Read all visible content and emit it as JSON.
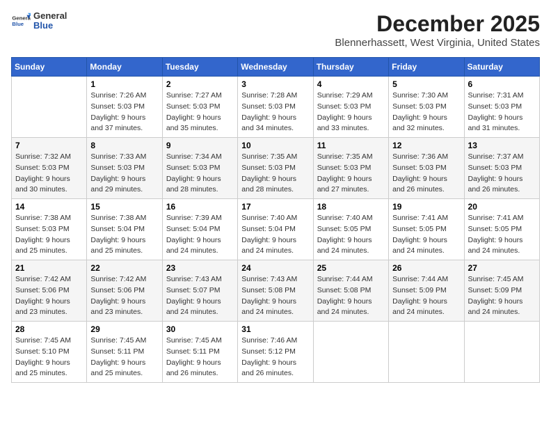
{
  "header": {
    "logo_general": "General",
    "logo_blue": "Blue",
    "title": "December 2025",
    "subtitle": "Blennerhassett, West Virginia, United States"
  },
  "columns": [
    "Sunday",
    "Monday",
    "Tuesday",
    "Wednesday",
    "Thursday",
    "Friday",
    "Saturday"
  ],
  "weeks": [
    [
      {
        "day": "",
        "info": ""
      },
      {
        "day": "1",
        "info": "Sunrise: 7:26 AM\nSunset: 5:03 PM\nDaylight: 9 hours\nand 37 minutes."
      },
      {
        "day": "2",
        "info": "Sunrise: 7:27 AM\nSunset: 5:03 PM\nDaylight: 9 hours\nand 35 minutes."
      },
      {
        "day": "3",
        "info": "Sunrise: 7:28 AM\nSunset: 5:03 PM\nDaylight: 9 hours\nand 34 minutes."
      },
      {
        "day": "4",
        "info": "Sunrise: 7:29 AM\nSunset: 5:03 PM\nDaylight: 9 hours\nand 33 minutes."
      },
      {
        "day": "5",
        "info": "Sunrise: 7:30 AM\nSunset: 5:03 PM\nDaylight: 9 hours\nand 32 minutes."
      },
      {
        "day": "6",
        "info": "Sunrise: 7:31 AM\nSunset: 5:03 PM\nDaylight: 9 hours\nand 31 minutes."
      }
    ],
    [
      {
        "day": "7",
        "info": "Sunrise: 7:32 AM\nSunset: 5:03 PM\nDaylight: 9 hours\nand 30 minutes."
      },
      {
        "day": "8",
        "info": "Sunrise: 7:33 AM\nSunset: 5:03 PM\nDaylight: 9 hours\nand 29 minutes."
      },
      {
        "day": "9",
        "info": "Sunrise: 7:34 AM\nSunset: 5:03 PM\nDaylight: 9 hours\nand 28 minutes."
      },
      {
        "day": "10",
        "info": "Sunrise: 7:35 AM\nSunset: 5:03 PM\nDaylight: 9 hours\nand 28 minutes."
      },
      {
        "day": "11",
        "info": "Sunrise: 7:35 AM\nSunset: 5:03 PM\nDaylight: 9 hours\nand 27 minutes."
      },
      {
        "day": "12",
        "info": "Sunrise: 7:36 AM\nSunset: 5:03 PM\nDaylight: 9 hours\nand 26 minutes."
      },
      {
        "day": "13",
        "info": "Sunrise: 7:37 AM\nSunset: 5:03 PM\nDaylight: 9 hours\nand 26 minutes."
      }
    ],
    [
      {
        "day": "14",
        "info": "Sunrise: 7:38 AM\nSunset: 5:03 PM\nDaylight: 9 hours\nand 25 minutes."
      },
      {
        "day": "15",
        "info": "Sunrise: 7:38 AM\nSunset: 5:04 PM\nDaylight: 9 hours\nand 25 minutes."
      },
      {
        "day": "16",
        "info": "Sunrise: 7:39 AM\nSunset: 5:04 PM\nDaylight: 9 hours\nand 24 minutes."
      },
      {
        "day": "17",
        "info": "Sunrise: 7:40 AM\nSunset: 5:04 PM\nDaylight: 9 hours\nand 24 minutes."
      },
      {
        "day": "18",
        "info": "Sunrise: 7:40 AM\nSunset: 5:05 PM\nDaylight: 9 hours\nand 24 minutes."
      },
      {
        "day": "19",
        "info": "Sunrise: 7:41 AM\nSunset: 5:05 PM\nDaylight: 9 hours\nand 24 minutes."
      },
      {
        "day": "20",
        "info": "Sunrise: 7:41 AM\nSunset: 5:05 PM\nDaylight: 9 hours\nand 24 minutes."
      }
    ],
    [
      {
        "day": "21",
        "info": "Sunrise: 7:42 AM\nSunset: 5:06 PM\nDaylight: 9 hours\nand 23 minutes."
      },
      {
        "day": "22",
        "info": "Sunrise: 7:42 AM\nSunset: 5:06 PM\nDaylight: 9 hours\nand 23 minutes."
      },
      {
        "day": "23",
        "info": "Sunrise: 7:43 AM\nSunset: 5:07 PM\nDaylight: 9 hours\nand 24 minutes."
      },
      {
        "day": "24",
        "info": "Sunrise: 7:43 AM\nSunset: 5:08 PM\nDaylight: 9 hours\nand 24 minutes."
      },
      {
        "day": "25",
        "info": "Sunrise: 7:44 AM\nSunset: 5:08 PM\nDaylight: 9 hours\nand 24 minutes."
      },
      {
        "day": "26",
        "info": "Sunrise: 7:44 AM\nSunset: 5:09 PM\nDaylight: 9 hours\nand 24 minutes."
      },
      {
        "day": "27",
        "info": "Sunrise: 7:45 AM\nSunset: 5:09 PM\nDaylight: 9 hours\nand 24 minutes."
      }
    ],
    [
      {
        "day": "28",
        "info": "Sunrise: 7:45 AM\nSunset: 5:10 PM\nDaylight: 9 hours\nand 25 minutes."
      },
      {
        "day": "29",
        "info": "Sunrise: 7:45 AM\nSunset: 5:11 PM\nDaylight: 9 hours\nand 25 minutes."
      },
      {
        "day": "30",
        "info": "Sunrise: 7:45 AM\nSunset: 5:11 PM\nDaylight: 9 hours\nand 26 minutes."
      },
      {
        "day": "31",
        "info": "Sunrise: 7:46 AM\nSunset: 5:12 PM\nDaylight: 9 hours\nand 26 minutes."
      },
      {
        "day": "",
        "info": ""
      },
      {
        "day": "",
        "info": ""
      },
      {
        "day": "",
        "info": ""
      }
    ]
  ]
}
